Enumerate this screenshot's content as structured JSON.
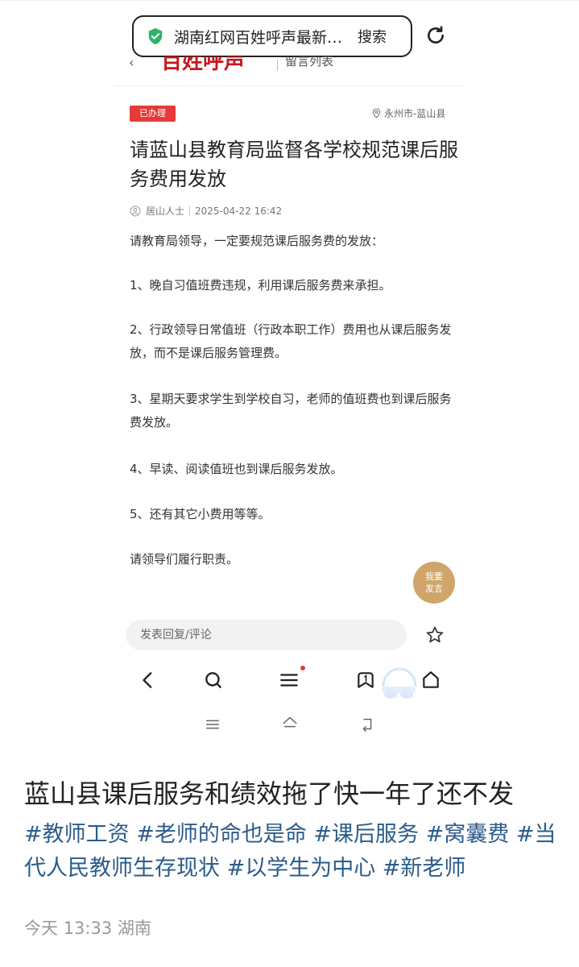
{
  "browser": {
    "search_text": "湖南红网百姓呼声最新…",
    "search_button": "搜索"
  },
  "article": {
    "status_badge": "已办理",
    "location": "永州市-蓝山县",
    "title": "请蓝山县教育局监督各学校规范课后服务费用发放",
    "author": "居山人士",
    "datetime": "2025-04-22 16:42",
    "paragraphs": [
      "请教育局领导，一定要规范课后服务费的发放：",
      "1、晚自习值班费违规，利用课后服务费来承担。",
      "2、行政领导日常值班（行政本职工作）费用也从课后服务发放，而不是课后服务管理费。",
      "3、星期天要求学生到学校自习，老师的值班费也到课后服务费发放。",
      "4、早读、阅读值班也到课后服务发放。",
      "5、还有其它小费用等等。",
      "请领导们履行职责。"
    ],
    "fab_line1": "我要",
    "fab_line2": "发言"
  },
  "comment": {
    "placeholder": "发表回复/评论"
  },
  "post": {
    "title": "蓝山县课后服务和绩效拖了快一年了还不发",
    "tags": "#教师工资 #老师的命也是命 #课后服务 #窝囊费 #当代人民教师生存现状 #以学生为中心 #新老师",
    "footer": "今天 13:33 湖南"
  },
  "colors": {
    "badge": "#e63a3a",
    "tag_link": "#2b5c8a",
    "fab": "#cfa56a",
    "shield": "#2fb36b"
  }
}
